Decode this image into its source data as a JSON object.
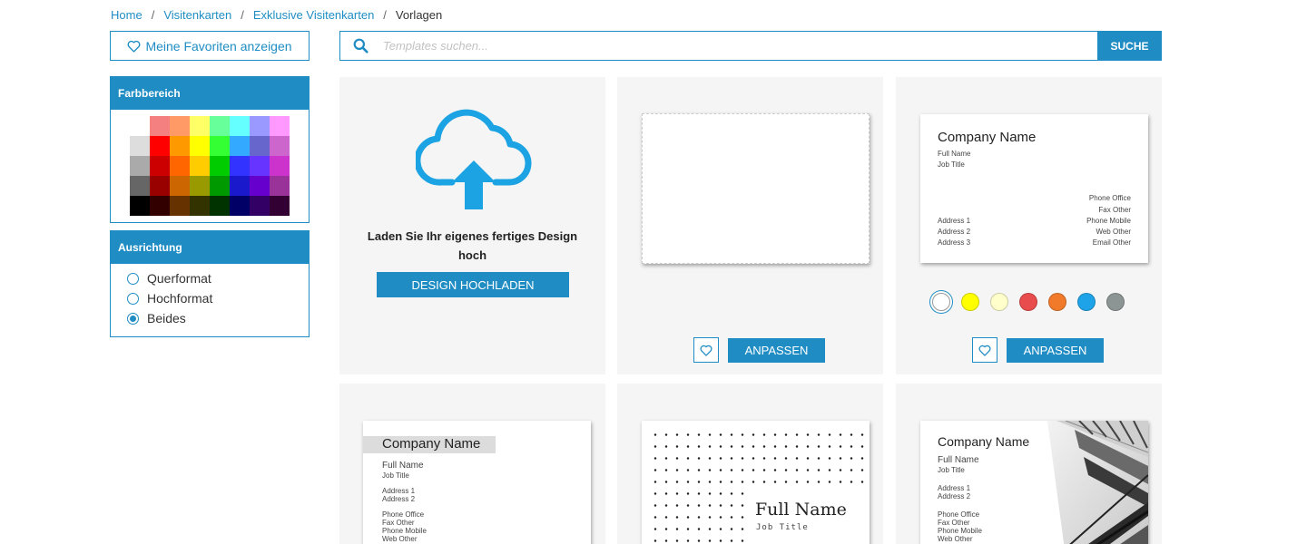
{
  "breadcrumb": {
    "items": [
      "Home",
      "Visitenkarten",
      "Exklusive Visitenkarten"
    ],
    "separator": "/",
    "current": "Vorlagen"
  },
  "sidebar": {
    "favorites_label": "Meine Favoriten anzeigen",
    "color_panel_title": "Farbbereich",
    "palette": [
      "#ffffff",
      "#f48080",
      "#ff9966",
      "#ffff66",
      "#66ff99",
      "#66ffff",
      "#9999ff",
      "#ff99ff",
      "#dddddd",
      "#ff0000",
      "#ff9900",
      "#ffff00",
      "#33ff33",
      "#33aaff",
      "#6666cc",
      "#cc66cc",
      "#aaaaaa",
      "#cc0000",
      "#ff6600",
      "#ffcc00",
      "#00cc00",
      "#3333ff",
      "#6633ff",
      "#cc33cc",
      "#666666",
      "#990000",
      "#cc6600",
      "#999900",
      "#009900",
      "#1a1acc",
      "#6600cc",
      "#993399",
      "#000000",
      "#330000",
      "#663300",
      "#333300",
      "#003300",
      "#000066",
      "#330066",
      "#330033"
    ],
    "orientation_title": "Ausrichtung",
    "orientation_options": [
      {
        "label": "Querformat",
        "checked": false
      },
      {
        "label": "Hochformat",
        "checked": false
      },
      {
        "label": "Beides",
        "checked": true
      }
    ]
  },
  "search": {
    "placeholder": "Templates suchen...",
    "button_label": "SUCHE"
  },
  "upload_tile": {
    "text": "Laden Sie Ihr eigenes fertiges Design hoch",
    "button_label": "DESIGN HOCHLADEN"
  },
  "actions": {
    "customize_label": "ANPASSEN"
  },
  "color_options": [
    "#ffffff",
    "#ffff00",
    "#ffffcc",
    "#e84c4c",
    "#f07a2a",
    "#1fa3e8",
    "#8c9494"
  ],
  "card_text": {
    "company": "Company Name",
    "full_name": "Full Name",
    "job_title": "Job Title",
    "address1": "Address 1",
    "address2": "Address 2",
    "address3": "Address 3",
    "phone_office": "Phone Office",
    "fax_other": "Fax Other",
    "phone_mobile": "Phone Mobile",
    "web_other": "Web Other",
    "email_other": "Email Other"
  },
  "colors": {
    "accent": "#1f8dc4",
    "tile_bg": "#f5f5f5"
  }
}
